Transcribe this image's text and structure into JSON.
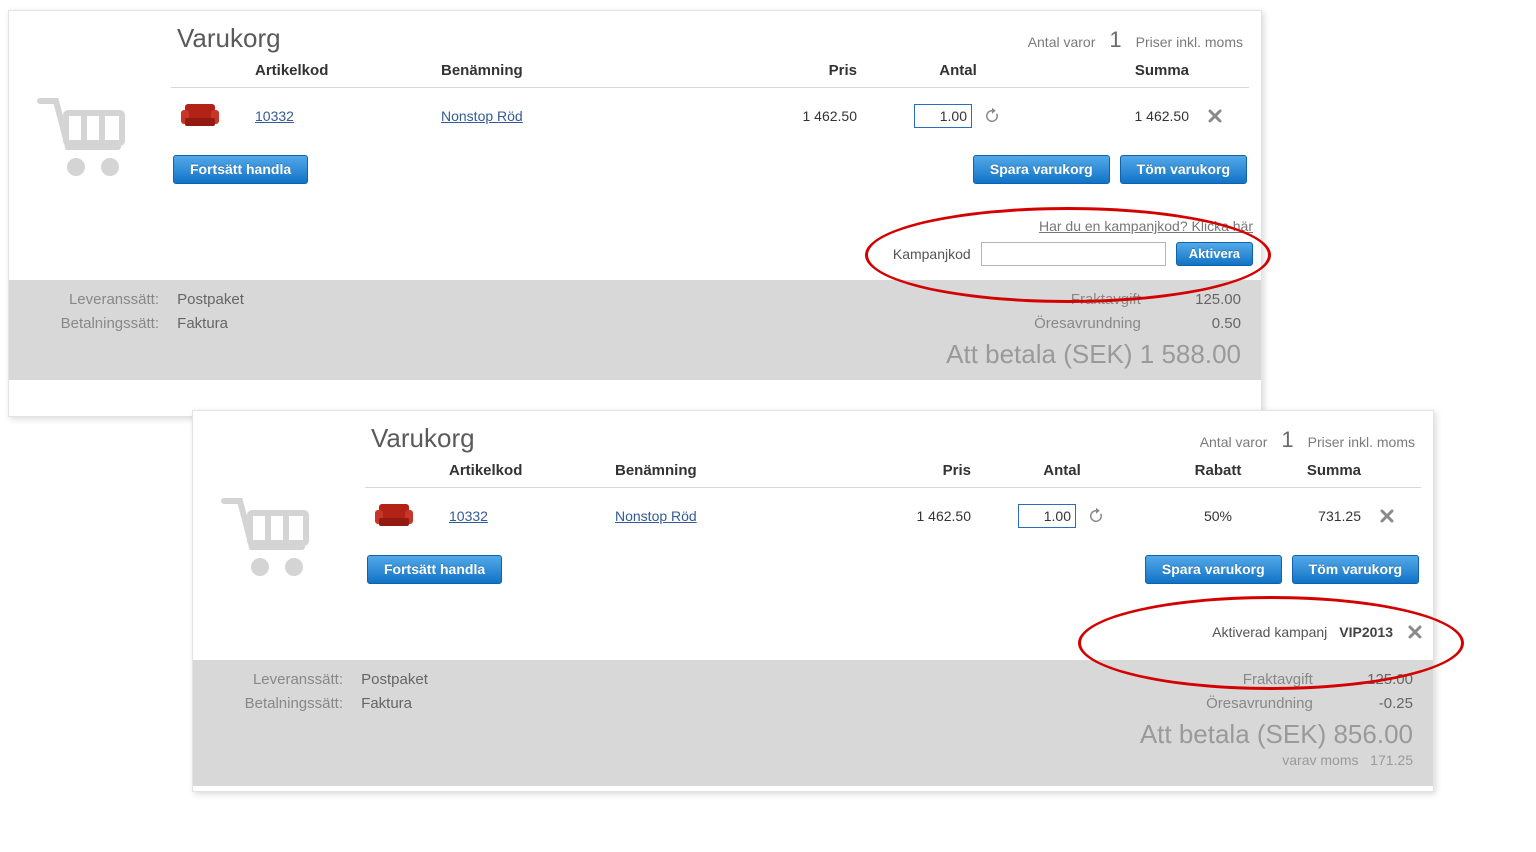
{
  "cart1": {
    "title": "Varukorg",
    "meta_count_label": "Antal varor",
    "meta_count": "1",
    "meta_tax": "Priser inkl. moms",
    "headers": {
      "thumb": "",
      "sku": "Artikelkod",
      "name": "Benämning",
      "price": "Pris",
      "qty": "Antal",
      "sum": "Summa"
    },
    "row": {
      "sku": "10332",
      "name": "Nonstop Röd",
      "price": "1 462.50",
      "qty": "1.00",
      "sum": "1 462.50"
    },
    "btn_continue": "Fortsätt handla",
    "btn_save": "Spara varukorg",
    "btn_empty": "Töm varukorg",
    "campaign_link": "Har du en kampanjkod? Klicka här",
    "campaign_label": "Kampanjkod",
    "campaign_btn": "Aktivera",
    "summary": {
      "delivery_label": "Leveranssätt:",
      "delivery_value": "Postpaket",
      "payment_label": "Betalningssätt:",
      "payment_value": "Faktura",
      "shipping_label": "Fraktavgift",
      "shipping_value": "125.00",
      "rounding_label": "Öresavrundning",
      "rounding_value": "0.50",
      "total_label": "Att betala (SEK)",
      "total_value": "1 588.00"
    }
  },
  "cart2": {
    "title": "Varukorg",
    "meta_count_label": "Antal varor",
    "meta_count": "1",
    "meta_tax": "Priser inkl. moms",
    "headers": {
      "thumb": "",
      "sku": "Artikelkod",
      "name": "Benämning",
      "price": "Pris",
      "qty": "Antal",
      "discount": "Rabatt",
      "sum": "Summa"
    },
    "row": {
      "sku": "10332",
      "name": "Nonstop Röd",
      "price": "1 462.50",
      "qty": "1.00",
      "discount": "50%",
      "sum": "731.25"
    },
    "btn_continue": "Fortsätt handla",
    "btn_save": "Spara varukorg",
    "btn_empty": "Töm varukorg",
    "activated_label": "Aktiverad kampanj",
    "activated_code": "VIP2013",
    "summary": {
      "delivery_label": "Leveranssätt:",
      "delivery_value": "Postpaket",
      "payment_label": "Betalningssätt:",
      "payment_value": "Faktura",
      "shipping_label": "Fraktavgift",
      "shipping_value": "125.00",
      "rounding_label": "Öresavrundning",
      "rounding_value": "-0.25",
      "total_label": "Att betala (SEK)",
      "total_value": "856.00",
      "vat_label": "varav moms",
      "vat_value": "171.25"
    }
  }
}
